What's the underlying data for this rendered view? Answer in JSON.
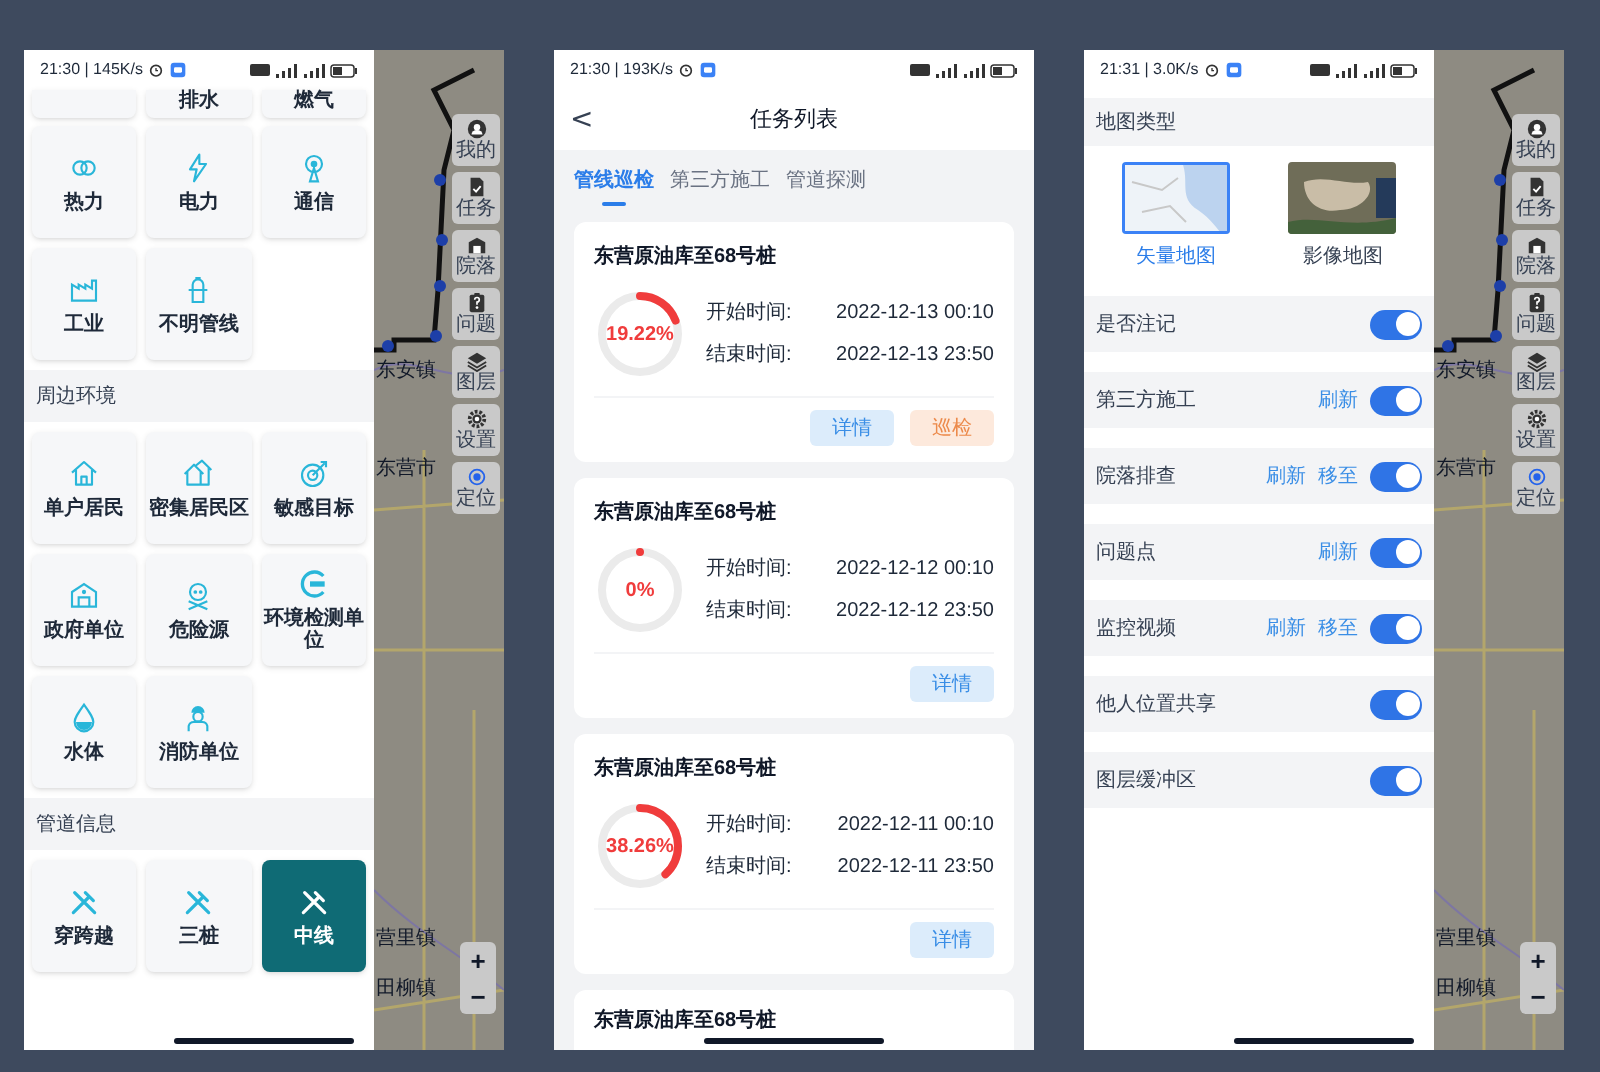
{
  "category_screen": {
    "status_bar": {
      "time_speed": "21:30 | 145K/s"
    },
    "top_row": [
      {
        "label": "排水"
      },
      {
        "label": "燃气"
      }
    ],
    "groups": [
      {
        "tiles": [
          {
            "kind": "heat",
            "label": "热力",
            "selected": false
          },
          {
            "kind": "power",
            "label": "电力",
            "selected": false
          },
          {
            "kind": "antenna",
            "label": "通信",
            "selected": false
          },
          {
            "kind": "factory",
            "label": "工业",
            "selected": false
          },
          {
            "kind": "hydrant",
            "label": "不明管线",
            "selected": false
          }
        ]
      },
      {
        "heading": "周边环境",
        "tiles": [
          {
            "kind": "house",
            "label": "单户居民",
            "selected": false
          },
          {
            "kind": "houses",
            "label": "密集居民区",
            "selected": false
          },
          {
            "kind": "target",
            "label": "敏感目标",
            "selected": false
          },
          {
            "kind": "building",
            "label": "政府单位",
            "selected": false
          },
          {
            "kind": "skull",
            "label": "危险源",
            "selected": false
          },
          {
            "kind": "ring",
            "label": "环境检测单位",
            "selected": false
          },
          {
            "kind": "drop",
            "label": "水体",
            "selected": false
          },
          {
            "kind": "worker",
            "label": "消防单位",
            "selected": false
          }
        ]
      },
      {
        "heading": "管道信息",
        "tiles": [
          {
            "kind": "tools",
            "label": "穿跨越",
            "selected": false
          },
          {
            "kind": "tools",
            "label": "三桩",
            "selected": false
          },
          {
            "kind": "tools",
            "label": "中线",
            "selected": true
          }
        ]
      }
    ],
    "map": {
      "toolbar": [
        {
          "kind": "user",
          "label": "我的"
        },
        {
          "kind": "task",
          "label": "任务"
        },
        {
          "kind": "yard",
          "label": "院落"
        },
        {
          "kind": "question",
          "label": "问题"
        },
        {
          "kind": "layers",
          "label": "图层"
        },
        {
          "kind": "gear",
          "label": "设置"
        },
        {
          "kind": "locate",
          "label": "定位"
        }
      ],
      "places": [
        "东安镇",
        "东营市",
        "营里镇",
        "田柳镇"
      ],
      "zoom": [
        "+",
        "−"
      ]
    }
  },
  "task_list_screen": {
    "status_bar": {
      "time_speed": "21:30 | 193K/s"
    },
    "header": {
      "back": "<",
      "title": "任务列表"
    },
    "tabs": [
      {
        "label": "管线巡检",
        "selected": true
      },
      {
        "label": "第三方施工",
        "selected": false
      },
      {
        "label": "管道探测",
        "selected": false
      }
    ],
    "tasks": [
      {
        "title": "东营原油库至68号桩",
        "level": 0.1922,
        "percent": "19.22%",
        "start_label": "开始时间:",
        "start": "2022-12-13 00:10",
        "end_label": "结束时间:",
        "end": "2022-12-13 23:50",
        "buttons": [
          {
            "kind": "detail",
            "label": "详情"
          },
          {
            "kind": "patrol",
            "label": "巡检"
          }
        ]
      },
      {
        "title": "东营原油库至68号桩",
        "level": 0,
        "percent": "0%",
        "start_label": "开始时间:",
        "start": "2022-12-12 00:10",
        "end_label": "结束时间:",
        "end": "2022-12-12 23:50",
        "buttons": [
          {
            "kind": "detail",
            "label": "详情"
          }
        ]
      },
      {
        "title": "东营原油库至68号桩",
        "level": 0.3826,
        "percent": "38.26%",
        "start_label": "开始时间:",
        "start": "2022-12-11 00:10",
        "end_label": "结束时间:",
        "end": "2022-12-11 23:50",
        "buttons": [
          {
            "kind": "detail",
            "label": "详情"
          }
        ]
      }
    ],
    "partial_task": {
      "title": "东营原油库至68号桩"
    }
  },
  "layer_settings_screen": {
    "status_bar": {
      "time_speed": "21:31 | 3.0K/s"
    },
    "section_title": "地图类型",
    "map_types": [
      {
        "kind": "vector",
        "label": "矢量地图",
        "selected": true
      },
      {
        "kind": "imagery",
        "label": "影像地图",
        "selected": false
      }
    ],
    "layers": [
      {
        "label": "是否注记",
        "on": true
      },
      {
        "label": "第三方施工",
        "on": true,
        "actions": [
          "刷新"
        ]
      },
      {
        "label": "院落排查",
        "on": true,
        "actions": [
          "刷新",
          "移至"
        ]
      },
      {
        "label": "问题点",
        "on": true,
        "actions": [
          "刷新"
        ]
      },
      {
        "label": "监控视频",
        "on": true,
        "actions": [
          "刷新",
          "移至"
        ]
      },
      {
        "label": "他人位置共享",
        "on": true
      },
      {
        "label": "图层缓冲区",
        "on": true
      }
    ],
    "map": {
      "toolbar": [
        {
          "kind": "user",
          "label": "我的"
        },
        {
          "kind": "task",
          "label": "任务"
        },
        {
          "kind": "yard",
          "label": "院落"
        },
        {
          "kind": "question",
          "label": "问题"
        },
        {
          "kind": "layers",
          "label": "图层"
        },
        {
          "kind": "gear",
          "label": "设置"
        },
        {
          "kind": "locate",
          "label": "定位"
        }
      ],
      "places": [
        "东安镇",
        "东营市",
        "营里镇",
        "田柳镇"
      ],
      "zoom": [
        "+",
        "−"
      ]
    }
  }
}
